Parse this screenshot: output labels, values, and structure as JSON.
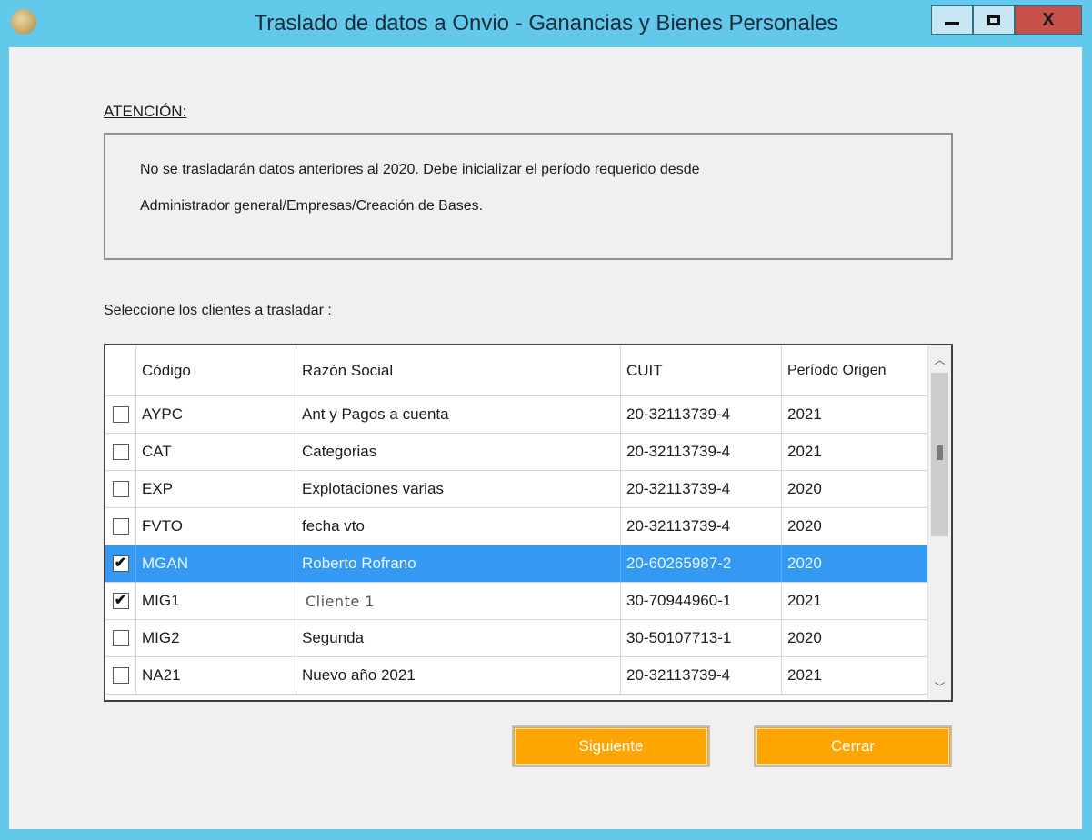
{
  "window": {
    "title": "Traslado de datos a Onvio - Ganancias y Bienes Personales",
    "close_glyph": "X"
  },
  "notice": {
    "label": "ATENCIÓN:",
    "line1": "No se trasladarán datos anteriores al 2020. Debe inicializar el período requerido desde",
    "line2": "Administrador general/Empresas/Creación de Bases."
  },
  "selection": {
    "label": "Seleccione los clientes a trasladar :"
  },
  "grid": {
    "columns": [
      "Código",
      "Razón Social",
      "CUIT",
      "Período Origen"
    ],
    "rows": [
      {
        "checked": false,
        "codigo": "AYPC",
        "razon": "Ant y Pagos  a cuenta",
        "cuit": "20-32113739-4",
        "periodo": "2021"
      },
      {
        "checked": false,
        "codigo": "CAT",
        "razon": "Categorias",
        "cuit": "20-32113739-4",
        "periodo": "2021"
      },
      {
        "checked": false,
        "codigo": "EXP",
        "razon": "Explotaciones varias",
        "cuit": "20-32113739-4",
        "periodo": "2020"
      },
      {
        "checked": false,
        "codigo": "FVTO",
        "razon": "fecha vto",
        "cuit": "20-32113739-4",
        "periodo": "2020"
      },
      {
        "checked": true,
        "codigo": "MGAN",
        "razon": "Roberto Rofrano",
        "cuit": "20-60265987-2",
        "periodo": "2020",
        "selected": true
      },
      {
        "checked": true,
        "codigo": "MIG1",
        "razon": "Cliente 1",
        "cuit": "30-70944960-1",
        "periodo": "2021"
      },
      {
        "checked": false,
        "codigo": "MIG2",
        "razon": "Segunda",
        "cuit": "30-50107713-1",
        "periodo": "2020"
      },
      {
        "checked": false,
        "codigo": "NA21",
        "razon": "Nuevo año 2021",
        "cuit": "20-32113739-4",
        "periodo": "2021"
      }
    ]
  },
  "buttons": {
    "next": "Siguiente",
    "close": "Cerrar"
  },
  "colors": {
    "titlebar": "#62c9ea",
    "selected_row": "#3399f3",
    "button": "#ffa500",
    "close_button": "#c7504a"
  },
  "icons": [
    "app-logo-icon",
    "minimize-icon",
    "maximize-icon",
    "close-icon",
    "checkmark-icon",
    "scroll-up-icon",
    "scroll-down-icon"
  ]
}
